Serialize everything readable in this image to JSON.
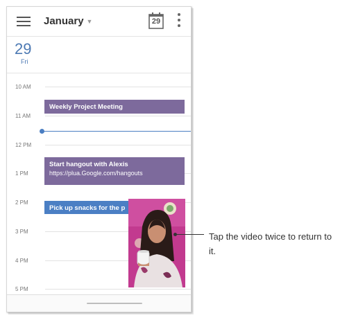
{
  "header": {
    "title": "January",
    "today_day": "29"
  },
  "day": {
    "number": "29",
    "weekday": "Fri"
  },
  "hours": [
    "10 AM",
    "11 AM",
    "12 PM",
    "1 PM",
    "2 PM",
    "3 PM",
    "4 PM",
    "5 PM"
  ],
  "events": [
    {
      "title": "Weekly Project Meeting",
      "subtitle": "",
      "color": "#7d6a9c"
    },
    {
      "title": "Start hangout with Alexis",
      "subtitle": "https://plua.Google.com/hangouts",
      "color": "#7d6a9c"
    },
    {
      "title": "Pick up snacks for the p",
      "subtitle": "",
      "color": "#4b7fc4"
    }
  ],
  "colors": {
    "accent": "#4c79b3",
    "now_indicator": "#4a7ec2"
  },
  "callout": {
    "text": "Tap the video twice to return to it."
  }
}
